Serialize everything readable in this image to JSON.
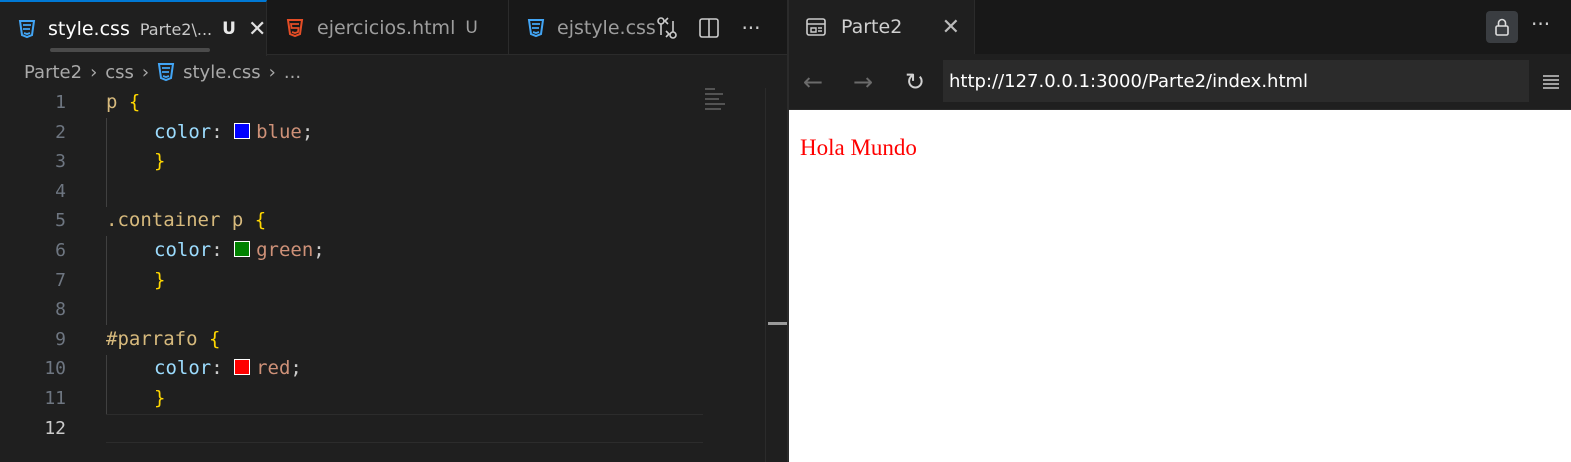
{
  "editor": {
    "tabs": [
      {
        "name": "style.css",
        "description": "Parte2\\...",
        "status": "U",
        "active": true
      },
      {
        "name": "ejercicios.html",
        "status": "U",
        "active": false
      },
      {
        "name": "ejstyle.css",
        "active": false
      }
    ],
    "tab_actions": [
      "compare-changes-icon",
      "split-editor-icon",
      "more-actions-icon"
    ],
    "more_glyph": "···",
    "breadcrumb": [
      "Parte2",
      "css",
      "style.css",
      "..."
    ],
    "lines": [
      {
        "n": "1",
        "text": [
          "p ",
          "{"
        ]
      },
      {
        "n": "2",
        "prop": "color",
        "swatch": "#0000ff",
        "value": "blue"
      },
      {
        "n": "3",
        "close": "}"
      },
      {
        "n": "4"
      },
      {
        "n": "5",
        "text": [
          ".container p ",
          "{"
        ]
      },
      {
        "n": "6",
        "prop": "color",
        "swatch": "#008000",
        "value": "green"
      },
      {
        "n": "7",
        "close": "}"
      },
      {
        "n": "8"
      },
      {
        "n": "9",
        "text": [
          "#parrafo ",
          "{"
        ]
      },
      {
        "n": "10",
        "prop": "color",
        "swatch": "#ff0000",
        "value": "red"
      },
      {
        "n": "11",
        "close": "}"
      },
      {
        "n": "12"
      }
    ],
    "current_line": "12",
    "colors": {
      "accent": "#0078d4",
      "selector": "#d7ba7d",
      "brace": "#ffd700",
      "property": "#9cdcfe",
      "value": "#ce9178"
    }
  },
  "browser": {
    "tab_title": "Parte2",
    "more_glyph": "···",
    "url": "http://127.0.0.1:3000/Parte2/index.html",
    "page_text": "Hola Mundo",
    "page_text_color": "#ff0000"
  }
}
